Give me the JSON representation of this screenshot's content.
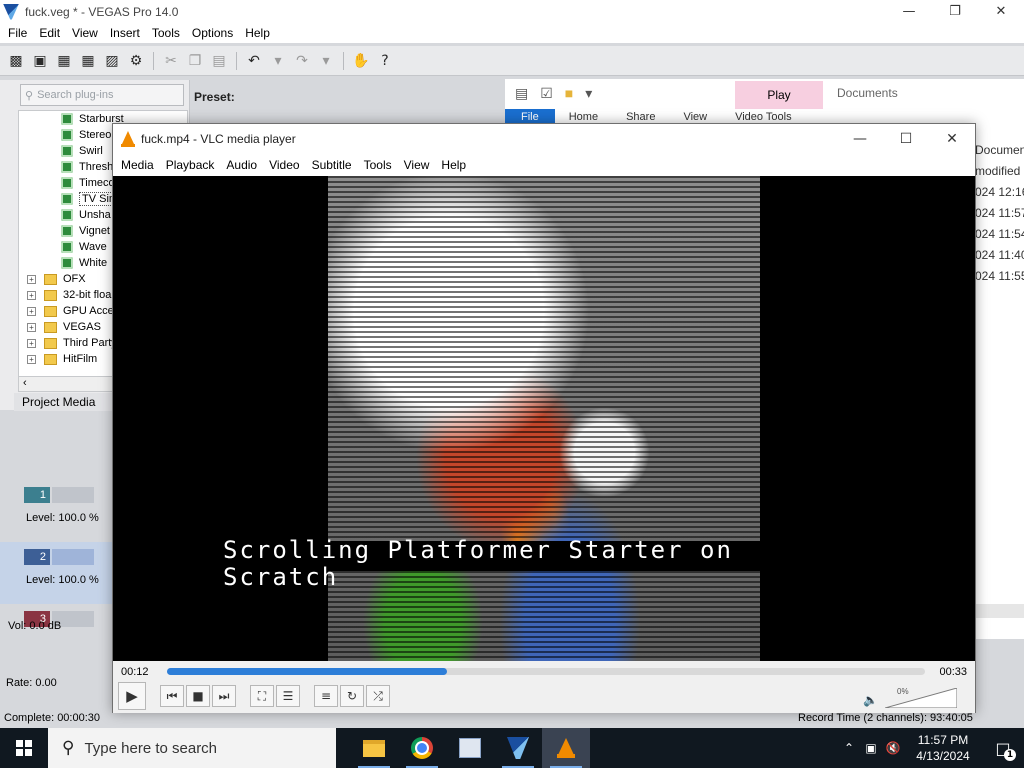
{
  "vegas": {
    "title": "fuck.veg * - VEGAS Pro 14.0",
    "menu": [
      "File",
      "Edit",
      "View",
      "Insert",
      "Tools",
      "Options",
      "Help"
    ],
    "search_placeholder": "Search plug-ins",
    "preset_label": "Preset:",
    "fx_items": [
      "Starburst",
      "Stereo",
      "Swirl",
      "Thresh",
      "Timeco",
      "TV Sim",
      "Unsha",
      "Vignet",
      "Wave",
      "White"
    ],
    "folders": [
      "OFX",
      "32-bit floa",
      "GPU Accel",
      "VEGAS",
      "Third Party",
      "HitFilm"
    ],
    "project_media_tab": "Project Media",
    "tracks": [
      {
        "number": "1",
        "level": "Level: 100.0 %"
      },
      {
        "number": "2",
        "level": "Level: 100.0 %"
      },
      {
        "number": "3",
        "level": "Vol:       0.0 dB"
      }
    ],
    "rate": "Rate: 0.00",
    "complete": "Complete: 00:00:30",
    "record_time": "Record Time (2 channels): 93:40:05"
  },
  "explorer": {
    "play_tab": "Play",
    "documents": "Documents",
    "ribbon": [
      "File",
      "Home",
      "Share",
      "View",
      "Video Tools"
    ],
    "column": [
      "Documen",
      "modified",
      "024 12:16",
      "024 11:57",
      "024 11:54",
      "024 11:40",
      "024 11:55"
    ]
  },
  "vlc": {
    "title": "fuck.mp4 - VLC media player",
    "menu": [
      "Media",
      "Playback",
      "Audio",
      "Video",
      "Subtitle",
      "Tools",
      "View",
      "Help"
    ],
    "subtitle_line1": "Scrolling Platformer Starter on",
    "subtitle_line2": "Scratch",
    "elapsed": "00:12",
    "total": "00:33",
    "progress_percent": 37,
    "volume": "0%"
  },
  "taskbar": {
    "search_placeholder": "Type here to search",
    "time": "11:57 PM",
    "date": "4/13/2024",
    "notification_count": "1"
  }
}
